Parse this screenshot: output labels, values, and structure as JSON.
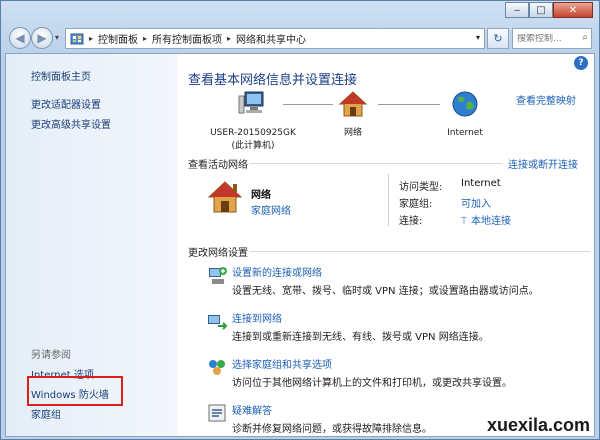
{
  "navbar": {
    "breadcrumb": [
      "控制面板",
      "所有控制面板项",
      "网络和共享中心"
    ],
    "search_placeholder": "搜索控制..."
  },
  "sidebar": {
    "top_links": [
      "控制面板主页",
      "更改适配器设置",
      "更改高级共享设置"
    ],
    "see_also_label": "另请参阅",
    "see_also_links": [
      "Internet 选项",
      "Windows 防火墙",
      "家庭组"
    ]
  },
  "main": {
    "title": "查看基本网络信息并设置连接",
    "full_map_link": "查看完整映射",
    "map": {
      "computer": [
        "USER-20150925GK",
        "(此计算机)"
      ],
      "network": "网络",
      "internet": "Internet"
    },
    "active_section": "查看活动网络",
    "connect_disconnect_link": "连接或断开连接",
    "active_network": {
      "name": "网络",
      "type": "家庭网络",
      "props": [
        {
          "label": "访问类型:",
          "value": "Internet"
        },
        {
          "label": "家庭组:",
          "value": "可加入"
        },
        {
          "label": "连接:",
          "value": "本地连接"
        }
      ]
    },
    "change_section": "更改网络设置",
    "tasks": [
      {
        "title": "设置新的连接或网络",
        "desc": "设置无线、宽带、拨号、临时或 VPN 连接；或设置路由器或访问点。"
      },
      {
        "title": "连接到网络",
        "desc": "连接到或重新连接到无线、有线、拨号或 VPN 网络连接。"
      },
      {
        "title": "选择家庭组和共享选项",
        "desc": "访问位于其他网络计算机上的文件和打印机，或更改共享设置。"
      },
      {
        "title": "疑难解答",
        "desc": "诊断并修复网络问题，或获得故障排除信息。"
      }
    ]
  },
  "watermark": "xuexila.com",
  "colors": {
    "link": "#1b5fb5",
    "title": "#1c3f86",
    "highlight_box": "#d9201c"
  }
}
